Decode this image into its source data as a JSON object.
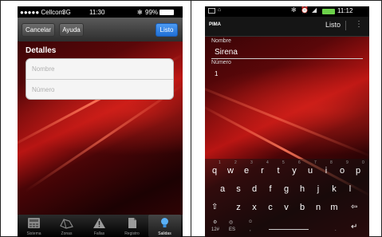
{
  "ios": {
    "carrier": "●●●●● Cellcom",
    "network": "3G",
    "time": "11:30",
    "battery": "99%",
    "buttons": {
      "cancel": "Cancelar",
      "help": "Ayuda",
      "done": "Listo"
    },
    "section": "Detalles",
    "fields": {
      "name_placeholder": "Nombre",
      "number_placeholder": "Número"
    },
    "tabs": [
      "Sistema",
      "Zonas",
      "Fallas",
      "Registro",
      "Salidas"
    ]
  },
  "android": {
    "time": "11:12",
    "brand": "PIMA",
    "done": "Listo",
    "menu": "⋮",
    "name_label": "Nombre",
    "name_value": "Sirena",
    "number_label": "Número",
    "number_value": "1",
    "keyboard": {
      "row1": [
        "q",
        "w",
        "e",
        "r",
        "t",
        "y",
        "u",
        "i",
        "o",
        "p"
      ],
      "row1_hints": [
        "1",
        "2",
        "3",
        "4",
        "5",
        "6",
        "7",
        "8",
        "9",
        "0"
      ],
      "row2": [
        "a",
        "s",
        "d",
        "f",
        "g",
        "h",
        "j",
        "k",
        "l"
      ],
      "row3": [
        "z",
        "x",
        "c",
        "v",
        "b",
        "n",
        "m"
      ],
      "mode_key": "12#",
      "lang_key": "ES",
      "comma": ",",
      "period": "."
    }
  }
}
